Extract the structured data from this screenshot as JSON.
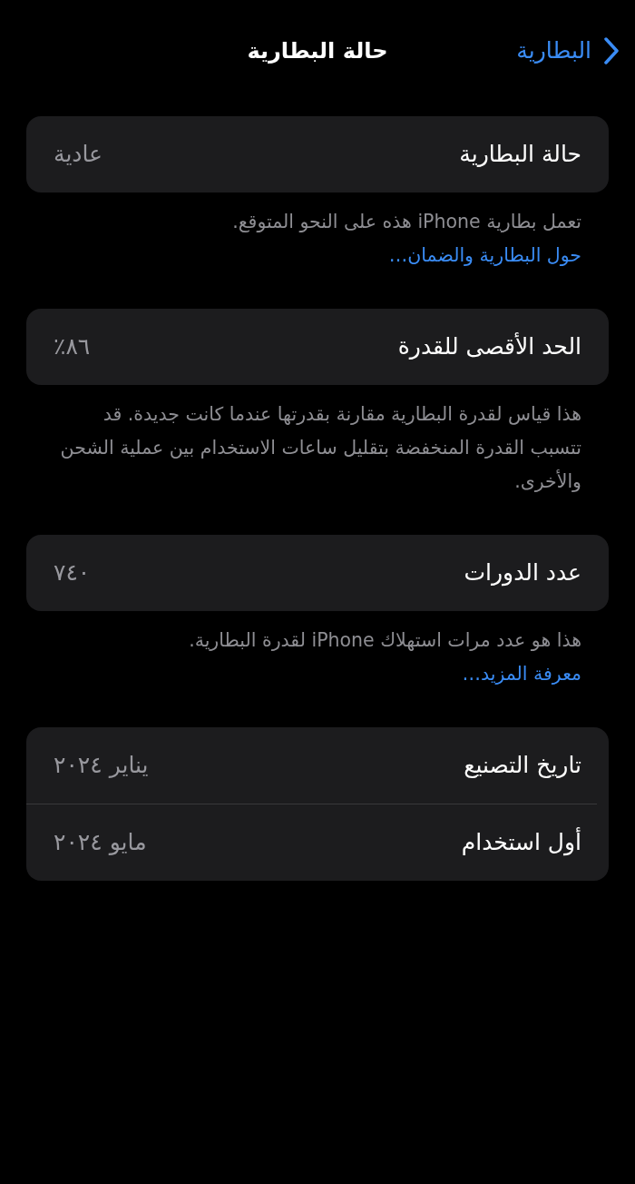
{
  "nav": {
    "back": "البطارية",
    "title": "حالة البطارية"
  },
  "groups": [
    {
      "rows": [
        {
          "label": "حالة البطارية",
          "value": "عادية"
        }
      ],
      "footer": {
        "kind": "inline",
        "text": "تعمل بطارية iPhone هذه على النحو المتوقع.",
        "link": "حول البطارية والضمان…"
      }
    },
    {
      "rows": [
        {
          "label": "الحد الأقصى للقدرة",
          "value": "٨٦٪"
        }
      ],
      "footer": {
        "kind": "inline",
        "text": "هذا قياس لقدرة البطارية مقارنة بقدرتها عندما كانت جديدة. قد تتسبب القدرة المنخفضة بتقليل ساعات الاستخدام بين عملية الشحن والأخرى."
      }
    },
    {
      "rows": [
        {
          "label": "عدد الدورات",
          "value": "٧٤٠"
        }
      ],
      "footer": {
        "kind": "stacked",
        "text": "هذا هو عدد مرات استهلاك iPhone لقدرة البطارية.",
        "link": "معرفة المزيد…"
      }
    },
    {
      "rows": [
        {
          "label": "تاريخ التصنيع",
          "value": "يناير ٢٠٢٤"
        },
        {
          "label": "أول استخدام",
          "value": "مايو ٢٠٢٤"
        }
      ]
    }
  ]
}
